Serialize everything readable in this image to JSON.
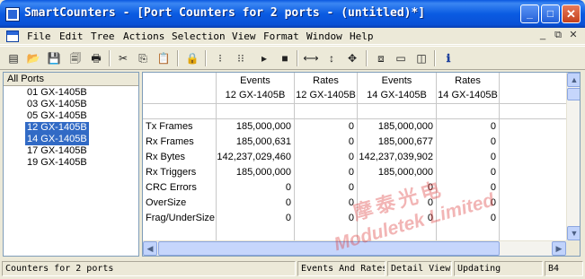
{
  "window": {
    "title": "SmartCounters - [Port Counters for 2 ports - (untitled)*]",
    "controls": {
      "minimize": "_",
      "maximize": "□",
      "close": "✕"
    }
  },
  "menu": {
    "items": [
      "File",
      "Edit",
      "Tree",
      "Actions",
      "Selection",
      "View",
      "Format",
      "Window",
      "Help"
    ],
    "mdi": {
      "minimize": "_",
      "restore": "⧉",
      "close": "✕"
    }
  },
  "toolbar": {
    "icons": [
      "new-icon",
      "open-icon",
      "save-icon",
      "save-as-icon",
      "print-icon",
      "cut-icon",
      "copy-icon",
      "paste-icon",
      "lock-icon",
      "start-icon",
      "start-all-icon",
      "play-icon",
      "stop-icon",
      "fit-width-icon",
      "fit-height-icon",
      "fit-all-icon",
      "tile-icon",
      "split-h-icon",
      "split-v-icon",
      "info-icon"
    ],
    "glyphs": [
      "▤",
      "📂",
      "💾",
      "🗐",
      "🖶",
      "✂",
      "⎘",
      "📋",
      "🔒",
      "⁝",
      "⁝⁝",
      "▸",
      "■",
      "⟷",
      "↕",
      "✥",
      "⧈",
      "▭",
      "◫",
      "ℹ"
    ]
  },
  "tree": {
    "header": "All Ports",
    "items": [
      {
        "label": "01 GX-1405B",
        "selected": false
      },
      {
        "label": "03 GX-1405B",
        "selected": false
      },
      {
        "label": "05 GX-1405B",
        "selected": false
      },
      {
        "label": "12 GX-1405B",
        "selected": true
      },
      {
        "label": "14 GX-1405B",
        "selected": true
      },
      {
        "label": "17 GX-1405B",
        "selected": false
      },
      {
        "label": "19 GX-1405B",
        "selected": false
      }
    ]
  },
  "grid": {
    "column_types": [
      "Events",
      "Rates",
      "Events",
      "Rates"
    ],
    "column_ports": [
      "12 GX-1405B",
      "12 GX-1405B",
      "14 GX-1405B",
      "14 GX-1405B"
    ],
    "rows": [
      {
        "label": "Tx Frames",
        "values": [
          "185,000,000",
          "0",
          "185,000,000",
          "0"
        ]
      },
      {
        "label": "Rx Frames",
        "values": [
          "185,000,631",
          "0",
          "185,000,677",
          "0"
        ]
      },
      {
        "label": "Rx Bytes",
        "values": [
          "142,237,029,460",
          "0",
          "142,237,039,902",
          "0"
        ]
      },
      {
        "label": "Rx Triggers",
        "values": [
          "185,000,000",
          "0",
          "185,000,000",
          "0"
        ]
      },
      {
        "label": "CRC Errors",
        "values": [
          "0",
          "0",
          "0",
          "0"
        ]
      },
      {
        "label": "OverSize",
        "values": [
          "0",
          "0",
          "0",
          "0"
        ]
      },
      {
        "label": "Frag/UnderSize",
        "values": [
          "0",
          "0",
          "0",
          "0"
        ]
      }
    ],
    "scroll": {
      "up": "▲",
      "down": "▼",
      "left": "◀",
      "right": "▶"
    }
  },
  "status": {
    "panes": [
      "Counters for 2 ports",
      "Events And Rates",
      "Detail View",
      "Updating",
      "B4"
    ]
  },
  "watermark": {
    "line1": "摩泰光电",
    "line2": "Moduletek Limited"
  },
  "colors": {
    "title_bar": "#0a5be2",
    "selection": "#316ac5",
    "chrome": "#ece9d8"
  }
}
